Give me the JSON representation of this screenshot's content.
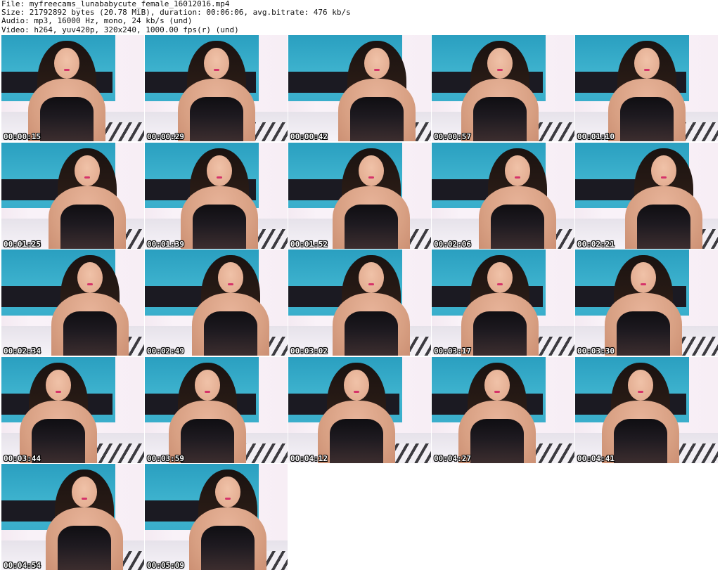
{
  "header": {
    "line1": "File: myfreecams_lunababycute_female_16012016.mp4",
    "line2": "Size: 21792892 bytes (20.78 MiB), duration: 00:06:06, avg.bitrate: 476 kb/s",
    "line3": "Audio: mp3, 16000 Hz, mono, 24 kb/s (und)",
    "line4": "Video: h264, yuv420p, 320x240, 1000.00 fps(r) (und)"
  },
  "thumbnails": [
    {
      "timestamp": "00:00:15"
    },
    {
      "timestamp": "00:00:29"
    },
    {
      "timestamp": "00:00:42"
    },
    {
      "timestamp": "00:00:57"
    },
    {
      "timestamp": "00:01:10"
    },
    {
      "timestamp": "00:01:25"
    },
    {
      "timestamp": "00:01:39"
    },
    {
      "timestamp": "00:01:52"
    },
    {
      "timestamp": "00:02:06"
    },
    {
      "timestamp": "00:02:21"
    },
    {
      "timestamp": "00:02:34"
    },
    {
      "timestamp": "00:02:49"
    },
    {
      "timestamp": "00:03:02"
    },
    {
      "timestamp": "00:03:17"
    },
    {
      "timestamp": "00:03:30"
    },
    {
      "timestamp": "00:03:44"
    },
    {
      "timestamp": "00:03:59"
    },
    {
      "timestamp": "00:04:12"
    },
    {
      "timestamp": "00:04:27"
    },
    {
      "timestamp": "00:04:41"
    },
    {
      "timestamp": "00:04:54"
    },
    {
      "timestamp": "00:05:09"
    }
  ],
  "colors": {
    "background": "#ffffff",
    "wall_panel": "#3aaecb",
    "headboard": "#1b1a22",
    "timestamp_text": "#ffffff"
  }
}
